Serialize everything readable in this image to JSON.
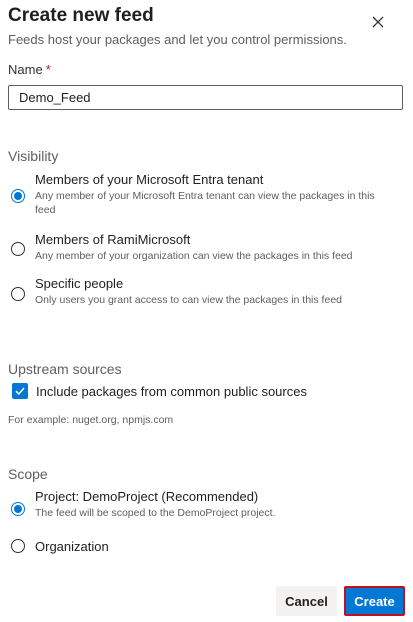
{
  "dialog": {
    "title": "Create new feed",
    "subtitle": "Feeds host your packages and let you control permissions.",
    "close_icon": "close-icon"
  },
  "name_field": {
    "label": "Name",
    "required_marker": "*",
    "value": "Demo_Feed"
  },
  "visibility": {
    "label": "Visibility",
    "selected": 0,
    "options": [
      {
        "title": "Members of your Microsoft Entra tenant",
        "description": "Any member of your Microsoft Entra tenant can view the packages in this feed"
      },
      {
        "title": "Members of RamiMicrosoft",
        "description": "Any member of your organization can view the packages in this feed"
      },
      {
        "title": "Specific people",
        "description": "Only users you grant access to can view the packages in this feed"
      }
    ]
  },
  "upstream": {
    "label": "Upstream sources",
    "checkbox_label": "Include packages from common public sources",
    "checked": true,
    "example": "For example: nuget.org, npmjs.com"
  },
  "scope": {
    "label": "Scope",
    "selected": 0,
    "options": [
      {
        "title": "Project: DemoProject (Recommended)",
        "description": "The feed will be scoped to the DemoProject project."
      },
      {
        "title": "Organization",
        "description": ""
      }
    ]
  },
  "buttons": {
    "cancel": "Cancel",
    "create": "Create"
  },
  "colors": {
    "accent": "#0078d4",
    "highlight_border": "#c50f1f",
    "required": "#a4262c"
  }
}
